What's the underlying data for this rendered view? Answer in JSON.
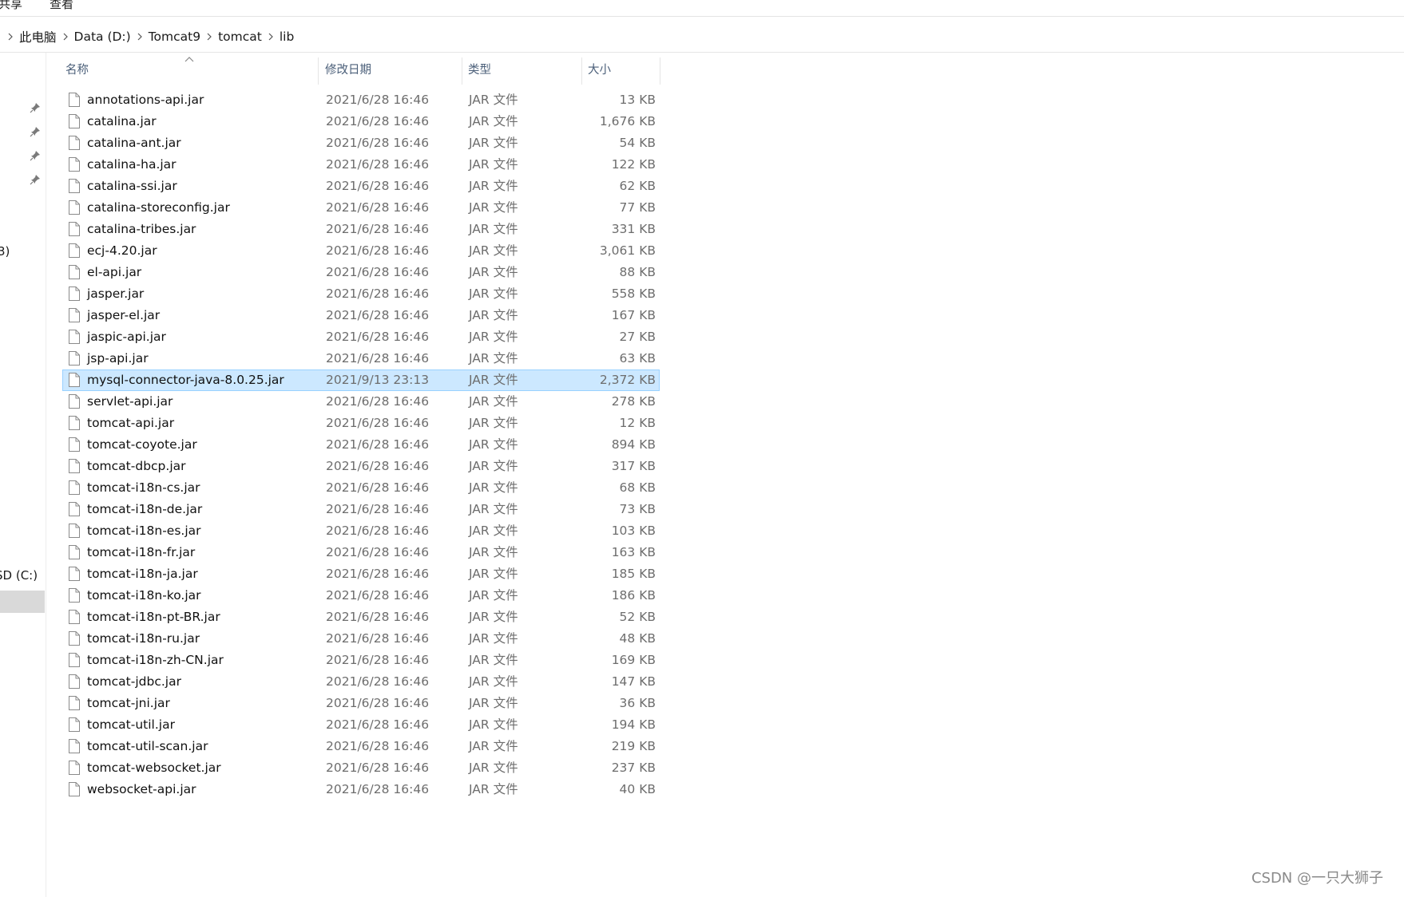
{
  "ribbon": {
    "tabs": [
      "共享",
      "查看"
    ]
  },
  "breadcrumb": [
    "此电脑",
    "Data (D:)",
    "Tomcat9",
    "tomcat",
    "lib"
  ],
  "navpane": {
    "fragments": [
      {
        "text": "3)"
      },
      {
        "text": "SD (C:)"
      }
    ]
  },
  "columns": {
    "name": "名称",
    "modified": "修改日期",
    "type": "类型",
    "size": "大小"
  },
  "files": [
    {
      "name": "annotations-api.jar",
      "modified": "2021/6/28 16:46",
      "type": "JAR 文件",
      "size": "13 KB"
    },
    {
      "name": "catalina.jar",
      "modified": "2021/6/28 16:46",
      "type": "JAR 文件",
      "size": "1,676 KB"
    },
    {
      "name": "catalina-ant.jar",
      "modified": "2021/6/28 16:46",
      "type": "JAR 文件",
      "size": "54 KB"
    },
    {
      "name": "catalina-ha.jar",
      "modified": "2021/6/28 16:46",
      "type": "JAR 文件",
      "size": "122 KB"
    },
    {
      "name": "catalina-ssi.jar",
      "modified": "2021/6/28 16:46",
      "type": "JAR 文件",
      "size": "62 KB"
    },
    {
      "name": "catalina-storeconfig.jar",
      "modified": "2021/6/28 16:46",
      "type": "JAR 文件",
      "size": "77 KB"
    },
    {
      "name": "catalina-tribes.jar",
      "modified": "2021/6/28 16:46",
      "type": "JAR 文件",
      "size": "331 KB"
    },
    {
      "name": "ecj-4.20.jar",
      "modified": "2021/6/28 16:46",
      "type": "JAR 文件",
      "size": "3,061 KB"
    },
    {
      "name": "el-api.jar",
      "modified": "2021/6/28 16:46",
      "type": "JAR 文件",
      "size": "88 KB"
    },
    {
      "name": "jasper.jar",
      "modified": "2021/6/28 16:46",
      "type": "JAR 文件",
      "size": "558 KB"
    },
    {
      "name": "jasper-el.jar",
      "modified": "2021/6/28 16:46",
      "type": "JAR 文件",
      "size": "167 KB"
    },
    {
      "name": "jaspic-api.jar",
      "modified": "2021/6/28 16:46",
      "type": "JAR 文件",
      "size": "27 KB"
    },
    {
      "name": "jsp-api.jar",
      "modified": "2021/6/28 16:46",
      "type": "JAR 文件",
      "size": "63 KB"
    },
    {
      "name": "mysql-connector-java-8.0.25.jar",
      "modified": "2021/9/13 23:13",
      "type": "JAR 文件",
      "size": "2,372 KB",
      "selected": true
    },
    {
      "name": "servlet-api.jar",
      "modified": "2021/6/28 16:46",
      "type": "JAR 文件",
      "size": "278 KB"
    },
    {
      "name": "tomcat-api.jar",
      "modified": "2021/6/28 16:46",
      "type": "JAR 文件",
      "size": "12 KB"
    },
    {
      "name": "tomcat-coyote.jar",
      "modified": "2021/6/28 16:46",
      "type": "JAR 文件",
      "size": "894 KB"
    },
    {
      "name": "tomcat-dbcp.jar",
      "modified": "2021/6/28 16:46",
      "type": "JAR 文件",
      "size": "317 KB"
    },
    {
      "name": "tomcat-i18n-cs.jar",
      "modified": "2021/6/28 16:46",
      "type": "JAR 文件",
      "size": "68 KB"
    },
    {
      "name": "tomcat-i18n-de.jar",
      "modified": "2021/6/28 16:46",
      "type": "JAR 文件",
      "size": "73 KB"
    },
    {
      "name": "tomcat-i18n-es.jar",
      "modified": "2021/6/28 16:46",
      "type": "JAR 文件",
      "size": "103 KB"
    },
    {
      "name": "tomcat-i18n-fr.jar",
      "modified": "2021/6/28 16:46",
      "type": "JAR 文件",
      "size": "163 KB"
    },
    {
      "name": "tomcat-i18n-ja.jar",
      "modified": "2021/6/28 16:46",
      "type": "JAR 文件",
      "size": "185 KB"
    },
    {
      "name": "tomcat-i18n-ko.jar",
      "modified": "2021/6/28 16:46",
      "type": "JAR 文件",
      "size": "186 KB"
    },
    {
      "name": "tomcat-i18n-pt-BR.jar",
      "modified": "2021/6/28 16:46",
      "type": "JAR 文件",
      "size": "52 KB"
    },
    {
      "name": "tomcat-i18n-ru.jar",
      "modified": "2021/6/28 16:46",
      "type": "JAR 文件",
      "size": "48 KB"
    },
    {
      "name": "tomcat-i18n-zh-CN.jar",
      "modified": "2021/6/28 16:46",
      "type": "JAR 文件",
      "size": "169 KB"
    },
    {
      "name": "tomcat-jdbc.jar",
      "modified": "2021/6/28 16:46",
      "type": "JAR 文件",
      "size": "147 KB"
    },
    {
      "name": "tomcat-jni.jar",
      "modified": "2021/6/28 16:46",
      "type": "JAR 文件",
      "size": "36 KB"
    },
    {
      "name": "tomcat-util.jar",
      "modified": "2021/6/28 16:46",
      "type": "JAR 文件",
      "size": "194 KB"
    },
    {
      "name": "tomcat-util-scan.jar",
      "modified": "2021/6/28 16:46",
      "type": "JAR 文件",
      "size": "219 KB"
    },
    {
      "name": "tomcat-websocket.jar",
      "modified": "2021/6/28 16:46",
      "type": "JAR 文件",
      "size": "237 KB"
    },
    {
      "name": "websocket-api.jar",
      "modified": "2021/6/28 16:46",
      "type": "JAR 文件",
      "size": "40 KB"
    }
  ],
  "file_icon": "file-icon",
  "colors": {
    "selection_bg": "#cce8ff",
    "selection_border": "#99d1ff",
    "header_text": "#4c607a"
  },
  "watermark": "CSDN @一只大狮子"
}
